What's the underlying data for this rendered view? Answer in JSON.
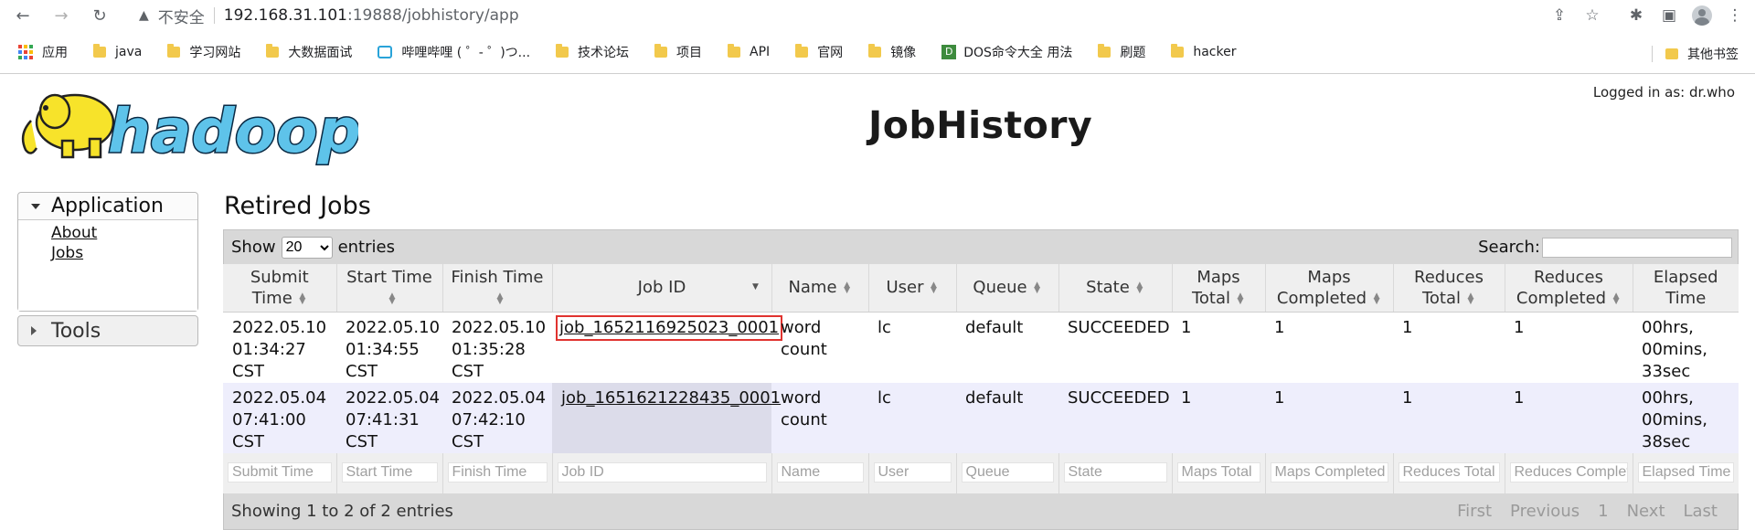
{
  "browser": {
    "insecure_label": "不安全",
    "url_host": "192.168.31.101",
    "url_path": ":19888/jobhistory/app",
    "bookmarks": [
      {
        "label": "应用",
        "kind": "apps"
      },
      {
        "label": "java",
        "kind": "folder"
      },
      {
        "label": "学习网站",
        "kind": "folder"
      },
      {
        "label": "大数据面试",
        "kind": "folder"
      },
      {
        "label": "哔哩哔哩 ( ゜- ゜)つ...",
        "kind": "bilibili"
      },
      {
        "label": "技术论坛",
        "kind": "folder"
      },
      {
        "label": "项目",
        "kind": "folder"
      },
      {
        "label": "API",
        "kind": "folder"
      },
      {
        "label": "官网",
        "kind": "folder"
      },
      {
        "label": "镜像",
        "kind": "folder"
      },
      {
        "label": "DOS命令大全 用法",
        "kind": "dos"
      },
      {
        "label": "刷题",
        "kind": "folder"
      },
      {
        "label": "hacker",
        "kind": "folder"
      }
    ],
    "other_bookmarks": "其他书签"
  },
  "header": {
    "logged_in": "Logged in as: dr.who",
    "title": "JobHistory",
    "logo_text": "hadoop"
  },
  "nav": {
    "application": "Application",
    "about": "About",
    "jobs": "Jobs",
    "tools": "Tools"
  },
  "main": {
    "section_title": "Retired Jobs",
    "show_label": "Show",
    "entries_value": "20",
    "entries_label": "entries",
    "search_label": "Search:",
    "columns": [
      "Submit Time",
      "Start Time",
      "Finish Time",
      "Job ID",
      "Name",
      "User",
      "Queue",
      "State",
      "Maps Total",
      "Maps Completed",
      "Reduces Total",
      "Reduces Completed",
      "Elapsed Time"
    ],
    "rows": [
      {
        "submit": "2022.05.10 01:34:27 CST",
        "start": "2022.05.10 01:34:55 CST",
        "finish": "2022.05.10 01:35:28 CST",
        "job_id": "job_1652116925023_0001",
        "name": "word count",
        "user": "lc",
        "queue": "default",
        "state": "SUCCEEDED",
        "maps_total": "1",
        "maps_completed": "1",
        "reduces_total": "1",
        "reduces_completed": "1",
        "elapsed": "00hrs, 00mins, 33sec"
      },
      {
        "submit": "2022.05.04 07:41:00 CST",
        "start": "2022.05.04 07:41:31 CST",
        "finish": "2022.05.04 07:42:10 CST",
        "job_id": "job_1651621228435_0001",
        "name": "word count",
        "user": "lc",
        "queue": "default",
        "state": "SUCCEEDED",
        "maps_total": "1",
        "maps_completed": "1",
        "reduces_total": "1",
        "reduces_completed": "1",
        "elapsed": "00hrs, 00mins, 38sec"
      }
    ],
    "showing": "Showing 1 to 2 of 2 entries",
    "pager": [
      "First",
      "Previous",
      "1",
      "Next",
      "Last"
    ]
  }
}
